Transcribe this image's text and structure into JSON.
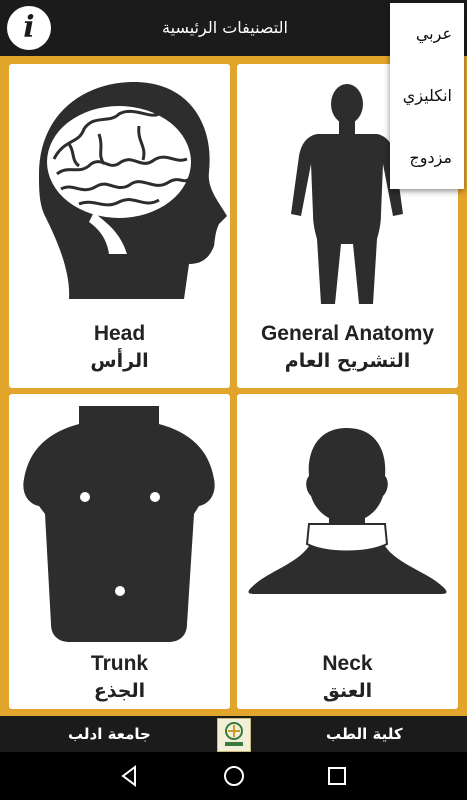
{
  "header": {
    "title": "التصنيفات الرئيسية",
    "info_icon": "i"
  },
  "language_menu": {
    "options": [
      "عربي",
      "انكليزي",
      "مزدوج"
    ]
  },
  "categories": [
    {
      "en": "Head",
      "ar": "الرأس",
      "icon": "head-brain-icon"
    },
    {
      "en": "General Anatomy",
      "ar": "التشريح العام",
      "icon": "body-figure-icon"
    },
    {
      "en": "Trunk",
      "ar": "الجذع",
      "icon": "trunk-icon"
    },
    {
      "en": "Neck",
      "ar": "العنق",
      "icon": "neck-icon"
    }
  ],
  "footer": {
    "left_label": "جامعة ادلب",
    "right_label": "كلية الطب",
    "logo_icon": "university-logo-icon"
  },
  "colors": {
    "accent": "#e2a52b",
    "bar": "#1b1b1b",
    "silhouette": "#2d2d2d"
  }
}
